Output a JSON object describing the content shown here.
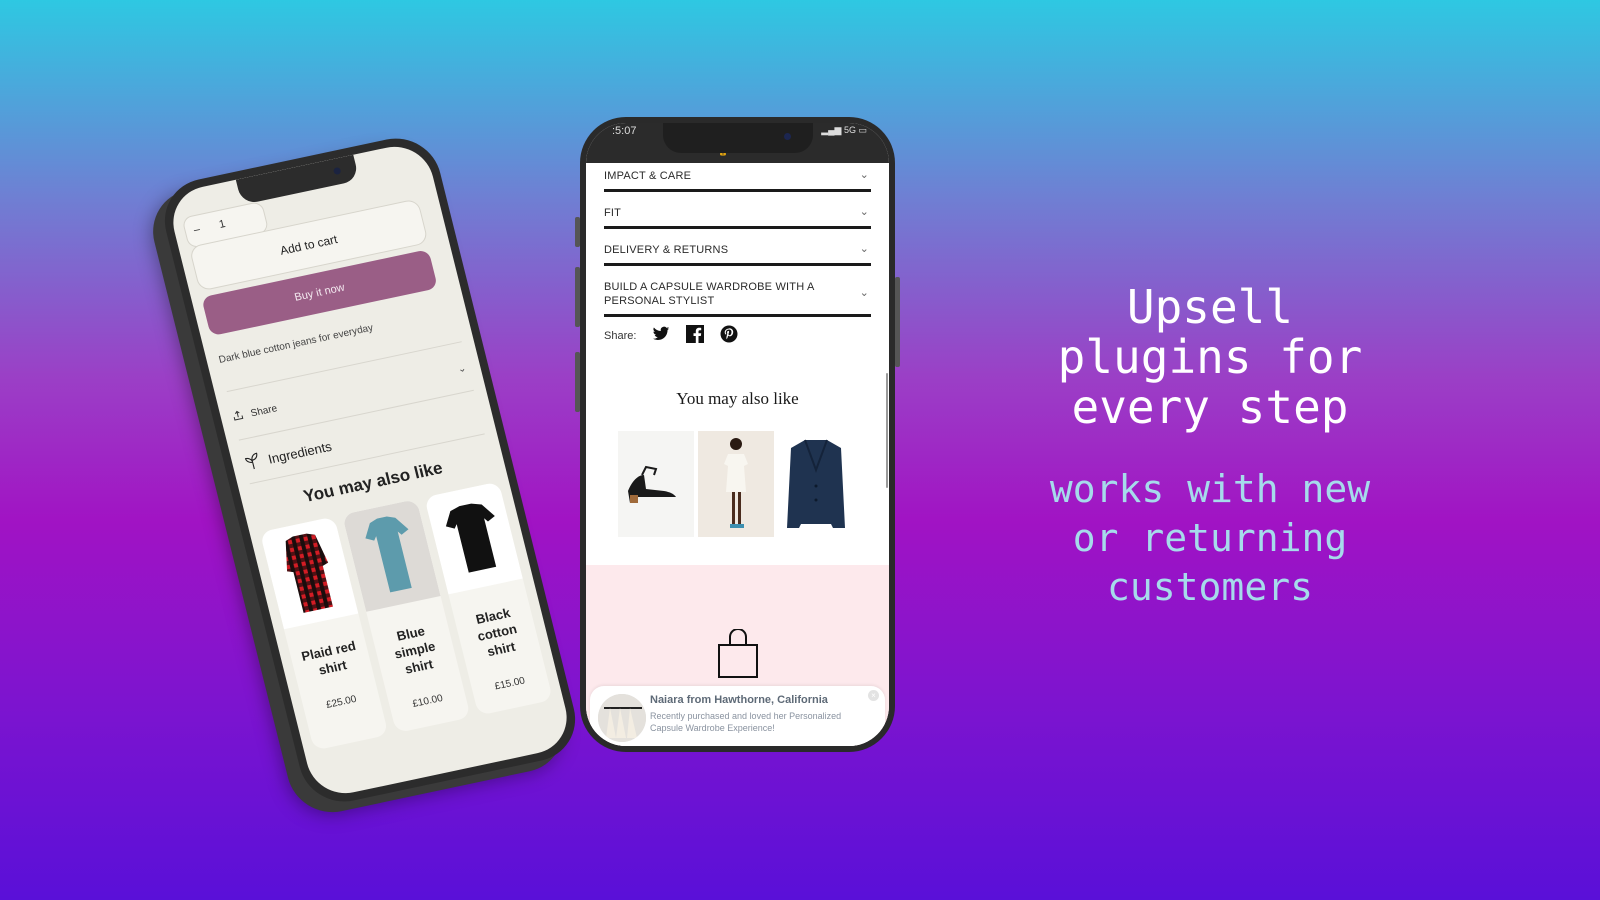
{
  "colors": {
    "buy_now": "#9a5e86",
    "headline": "#ffffff",
    "subline": "#a6dbeb",
    "pink_section": "#fde9ec"
  },
  "headline": {
    "lines": [
      "Upsell",
      "plugins for",
      "every step"
    ]
  },
  "subline": {
    "lines": [
      "works with new",
      "or returning",
      "customers"
    ]
  },
  "left_phone": {
    "quantity_minus": "–",
    "quantity_value": "1",
    "add_to_cart": "Add to cart",
    "buy_now": "Buy it now",
    "description": "Dark blue cotton jeans for everyday",
    "share_label": "Share",
    "share_icon": "share-icon",
    "ingredients_label": "Ingredients",
    "ingredients_icon": "leaf-icon",
    "section_title": "You may also like",
    "products": [
      {
        "name": "Plaid red shirt",
        "price": "£25.00",
        "image": "plaid-shirt"
      },
      {
        "name": "Blue simple shirt",
        "price": "£10.00",
        "image": "blue-tshirt"
      },
      {
        "name": "Black cotton shirt",
        "price": "£15.00",
        "image": "black-tshirt"
      }
    ]
  },
  "center_phone": {
    "status_time": ":5:07",
    "status_right": "5G",
    "accordion": [
      {
        "label": "IMPACT & CARE"
      },
      {
        "label": "FIT"
      },
      {
        "label": "DELIVERY & RETURNS"
      },
      {
        "label": "BUILD A CAPSULE WARDROBE WITH A PERSONAL STYLIST"
      }
    ],
    "share_label": "Share:",
    "share_icons": [
      "twitter-icon",
      "facebook-icon",
      "pinterest-icon"
    ],
    "section_title": "You may also like",
    "products": [
      {
        "image": "black-sandals"
      },
      {
        "image": "white-dress"
      },
      {
        "image": "navy-blazer"
      }
    ],
    "toast": {
      "title": "Naiara from Hawthorne, California",
      "body": "Recently purchased and loved her Personalized Capsule Wardrobe Experience!"
    }
  }
}
